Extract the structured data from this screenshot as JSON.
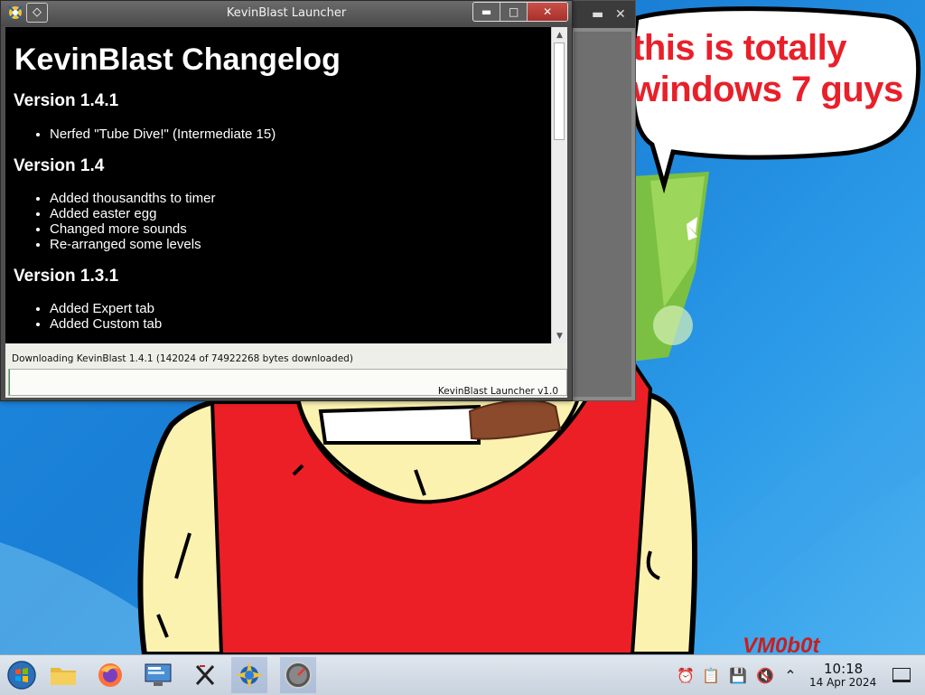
{
  "colors": {
    "desktop_blue": "#1d8be0",
    "bubble_text": "#e8202a",
    "progress_fill": "#3c9c4a"
  },
  "desktop": {
    "bubble_line1": "this is totally",
    "bubble_line2": "windows 7 guys",
    "signature": "VM0b0t"
  },
  "window": {
    "title": "KevinBlast Launcher",
    "pin_icon": "pin-icon",
    "minimize_icon": "minimize-icon",
    "maximize_icon": "maximize-icon",
    "close_icon": "close-icon"
  },
  "changelog": {
    "heading": "KevinBlast Changelog",
    "versions": [
      {
        "title": "Version 1.4.1",
        "items": [
          "Nerfed \"Tube Dive!\" (Intermediate 15)"
        ]
      },
      {
        "title": "Version 1.4",
        "items": [
          "Added thousandths to timer",
          "Added easter egg",
          "Changed more sounds",
          "Re-arranged some levels"
        ]
      },
      {
        "title": "Version 1.3.1",
        "items": [
          "Added Expert tab",
          "Added Custom tab"
        ]
      }
    ]
  },
  "status": {
    "download_text": "Downloading KevinBlast 1.4.1 (142024 of 74922268 bytes downloaded)",
    "progress_fraction": 0.0019,
    "version_label": "KevinBlast Launcher v1.0"
  },
  "taskbar": {
    "items": [
      {
        "name": "start-button",
        "icon": "windows-orb-icon"
      },
      {
        "name": "file-manager-button",
        "icon": "folder-icon"
      },
      {
        "name": "firefox-button",
        "icon": "firefox-icon"
      },
      {
        "name": "settings-button",
        "icon": "computer-icon"
      },
      {
        "name": "x-app-button",
        "icon": "x-icon"
      },
      {
        "name": "kevinblast-launcher-button",
        "icon": "kevinblast-icon"
      },
      {
        "name": "speedometer-app-button",
        "icon": "gauge-icon"
      }
    ],
    "tray": [
      "notifications-icon",
      "clipboard-icon",
      "removable-drive-icon",
      "volume-muted-icon",
      "chevron-up-icon"
    ],
    "time": "10:18",
    "date": "14 Apr 2024",
    "show_desktop_icon": "show-desktop-icon"
  }
}
